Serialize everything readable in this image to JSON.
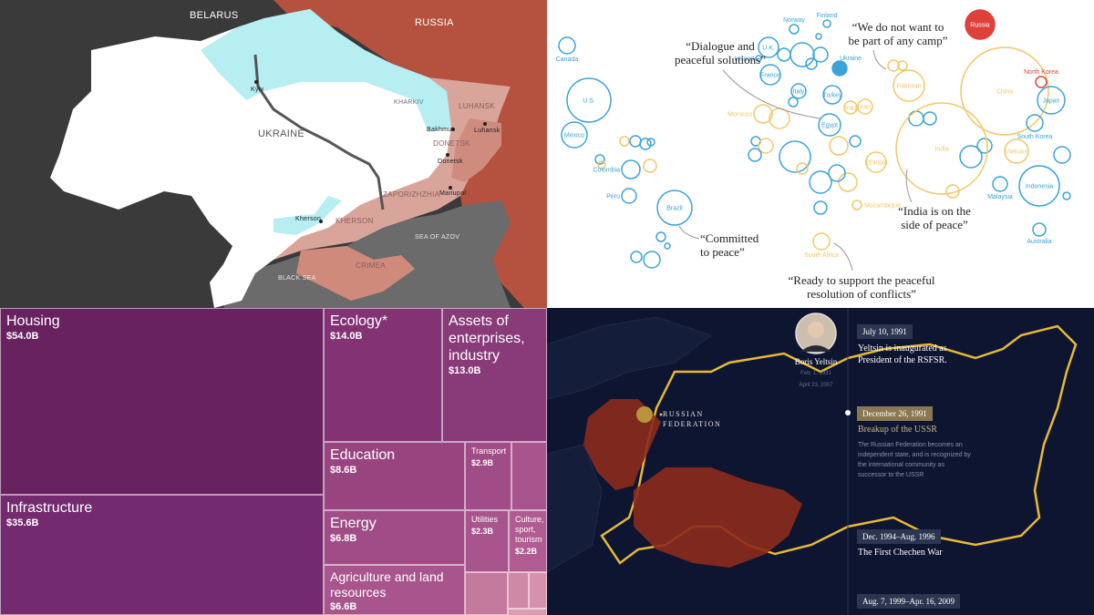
{
  "panels": {
    "ukraine_map": {
      "labels": {
        "belarus": "BELARUS",
        "russia": "RUSSIA",
        "ukraine": "UKRAINE",
        "kharkiv": "KHARKIV",
        "luhansk_region": "LUHANSK",
        "donetsk_region": "DONETSK",
        "zaporizhzhia": "ZAPORIZHZHIA",
        "kherson_region": "KHERSON",
        "crimea": "CRIMEA",
        "sea_of_azov": "SEA OF AZOV",
        "black_sea": "BLACK SEA"
      },
      "cities": {
        "kyiv": "Kyiv",
        "bakhmut": "Bakhmut",
        "luhansk": "Luhansk",
        "donetsk": "Donetsk",
        "mariupol": "Mariupol",
        "kherson": "Kherson"
      },
      "colors": {
        "ukraine": "#ffffff",
        "russia": "#b5513f",
        "occupied": "#d9a59a",
        "liberated": "#b6eef2",
        "neighbours": "#3a3a3a",
        "sea": "#6b6b6b"
      }
    },
    "bubble_chart": {
      "quotes": {
        "dialogue": "“Dialogue and peaceful solutions”",
        "dialogue_l1": "“Dialogue and",
        "dialogue_l2": "peaceful solutions”",
        "camp_l1": "“We do not want to",
        "camp_l2": "be part of any camp”",
        "peace_l1": "“Committed",
        "peace_l2": "to peace”",
        "india_l1": "“India is on the",
        "india_l2": "side of peace”",
        "ready_l1": "“Ready to support the peaceful",
        "ready_l2": "resolution of conflicts”"
      },
      "colors": {
        "blue": "#3ba3d8",
        "yellow": "#f2c76a",
        "red": "#e0403a"
      },
      "countries": [
        {
          "name": "Canada",
          "group": "blue"
        },
        {
          "name": "U.S.",
          "group": "blue"
        },
        {
          "name": "Mexico",
          "group": "blue"
        },
        {
          "name": "Colombia",
          "group": "blue"
        },
        {
          "name": "Peru",
          "group": "blue"
        },
        {
          "name": "Brazil",
          "group": "blue"
        },
        {
          "name": "Norway",
          "group": "blue"
        },
        {
          "name": "Finland",
          "group": "blue"
        },
        {
          "name": "U.K.",
          "group": "blue"
        },
        {
          "name": "Ireland",
          "group": "blue"
        },
        {
          "name": "France",
          "group": "blue"
        },
        {
          "name": "Italy",
          "group": "blue"
        },
        {
          "name": "Ukraine",
          "group": "blue"
        },
        {
          "name": "Turkey",
          "group": "blue"
        },
        {
          "name": "Egypt",
          "group": "blue"
        },
        {
          "name": "Morocco",
          "group": "yellow"
        },
        {
          "name": "Iraq",
          "group": "yellow"
        },
        {
          "name": "Iran",
          "group": "yellow"
        },
        {
          "name": "Pakistan",
          "group": "yellow"
        },
        {
          "name": "India",
          "group": "yellow"
        },
        {
          "name": "China",
          "group": "yellow"
        },
        {
          "name": "Ethiopia",
          "group": "yellow"
        },
        {
          "name": "Mozambique",
          "group": "yellow"
        },
        {
          "name": "South Africa",
          "group": "yellow"
        },
        {
          "name": "Vietnam",
          "group": "yellow"
        },
        {
          "name": "Russia",
          "group": "red"
        },
        {
          "name": "North Korea",
          "group": "red"
        },
        {
          "name": "Japan",
          "group": "blue"
        },
        {
          "name": "South Korea",
          "group": "blue"
        },
        {
          "name": "Malaysia",
          "group": "blue"
        },
        {
          "name": "Indonesia",
          "group": "blue"
        },
        {
          "name": "Australia",
          "group": "blue"
        }
      ]
    },
    "treemap": {
      "colors": {
        "base": "#6b2469"
      },
      "cells": [
        {
          "name": "Housing",
          "value": "$54.0B"
        },
        {
          "name": "Infrastructure",
          "value": "$35.6B"
        },
        {
          "name": "Ecology*",
          "value": "$14.0B"
        },
        {
          "name": "Assets of enterprises, industry",
          "value": "$13.0B"
        },
        {
          "name": "Education",
          "value": "$8.6B"
        },
        {
          "name": "Transport",
          "value": "$2.9B"
        },
        {
          "name": "Energy",
          "value": "$6.8B"
        },
        {
          "name": "Utilities",
          "value": "$2.3B"
        },
        {
          "name": "Culture, sport, tourism",
          "value": "$2.2B"
        },
        {
          "name": "Agriculture and land resources",
          "value": "$6.6B"
        }
      ]
    },
    "timeline_map": {
      "label_federation_l1": "RUSSIAN",
      "label_federation_l2": "FEDERATION",
      "person": {
        "name": "Boris Yeltsin",
        "born": "Feb. 1, 1931",
        "died": "April 23, 2007"
      },
      "events": [
        {
          "date": "July 10, 1991",
          "title": "Yeltsin is inaugurated as President of the RSFSR.",
          "title_l1": "Yeltsin is inaugurated as",
          "title_l2": "President of the RSFSR.",
          "active": false
        },
        {
          "date": "December 26, 1991",
          "title": "Breakup of the USSR",
          "body": "The Russian Federation becomes an independent state, and is recognized by the international community as successor to the USSR",
          "active": true
        },
        {
          "date": "Dec. 1994–Aug. 1996",
          "title": "The First Chechen War",
          "active": false
        },
        {
          "date": "Aug. 7, 1999–Apr. 16, 2009",
          "active": false
        }
      ],
      "colors": {
        "border": "#e8b935",
        "territory": "#8c2a1c",
        "bg": "#0d1530"
      }
    }
  }
}
